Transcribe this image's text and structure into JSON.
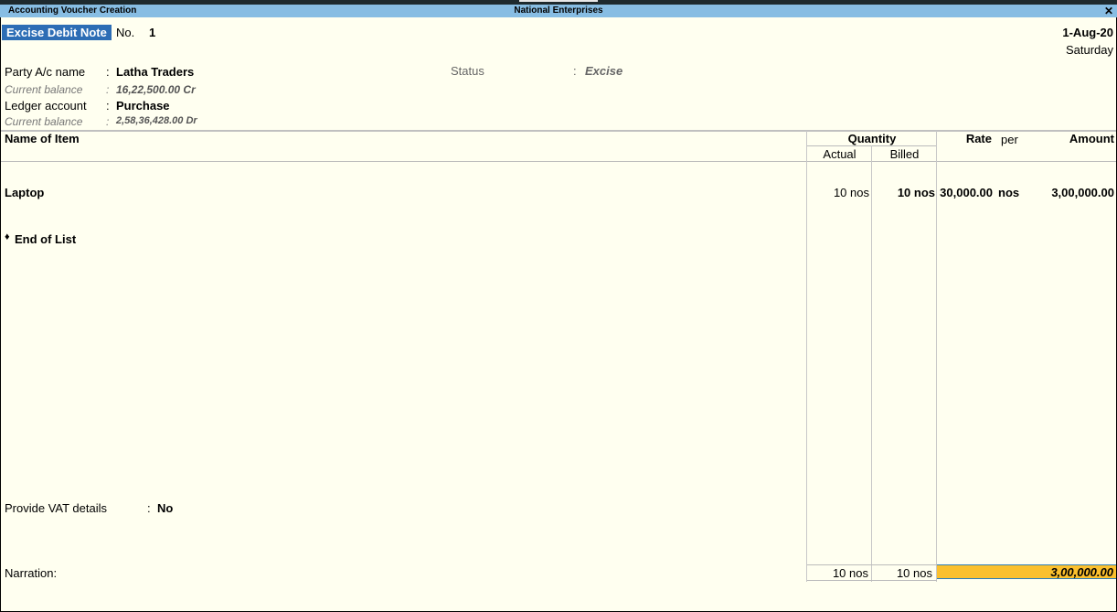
{
  "window": {
    "title_left": "Accounting Voucher Creation",
    "title_center": "National Enterprises",
    "close_icon": "close-icon"
  },
  "voucher": {
    "type": "Excise Debit Note",
    "no_label": "No.",
    "no": "1",
    "date": "1-Aug-20",
    "day": "Saturday"
  },
  "party": {
    "label": "Party A/c name",
    "colon": ":",
    "value": "Latha Traders",
    "balance_label": "Current balance",
    "balance_value": "16,22,500.00 Cr"
  },
  "ledger": {
    "label": "Ledger account",
    "colon": ":",
    "value": "Purchase",
    "balance_label": "Current balance",
    "balance_value": "2,58,36,428.00 Dr"
  },
  "status": {
    "label": "Status",
    "colon": ":",
    "value": "Excise"
  },
  "table": {
    "headers": {
      "name": "Name of Item",
      "quantity": "Quantity",
      "actual": "Actual",
      "billed": "Billed",
      "rate": "Rate",
      "per": "per",
      "amount": "Amount"
    },
    "rows": [
      {
        "name": "Laptop",
        "actual": "10 nos",
        "billed": "10 nos",
        "rate": "30,000.00",
        "per": "nos",
        "amount": "3,00,000.00"
      }
    ],
    "end_of_list_icon": "♦",
    "end_of_list": "End of List"
  },
  "vat": {
    "label": "Provide VAT details",
    "colon": ":",
    "value": "No"
  },
  "narration": {
    "label": "Narration:"
  },
  "totals": {
    "actual": "10 nos",
    "billed": "10 nos",
    "amount": "3,00,000.00"
  }
}
